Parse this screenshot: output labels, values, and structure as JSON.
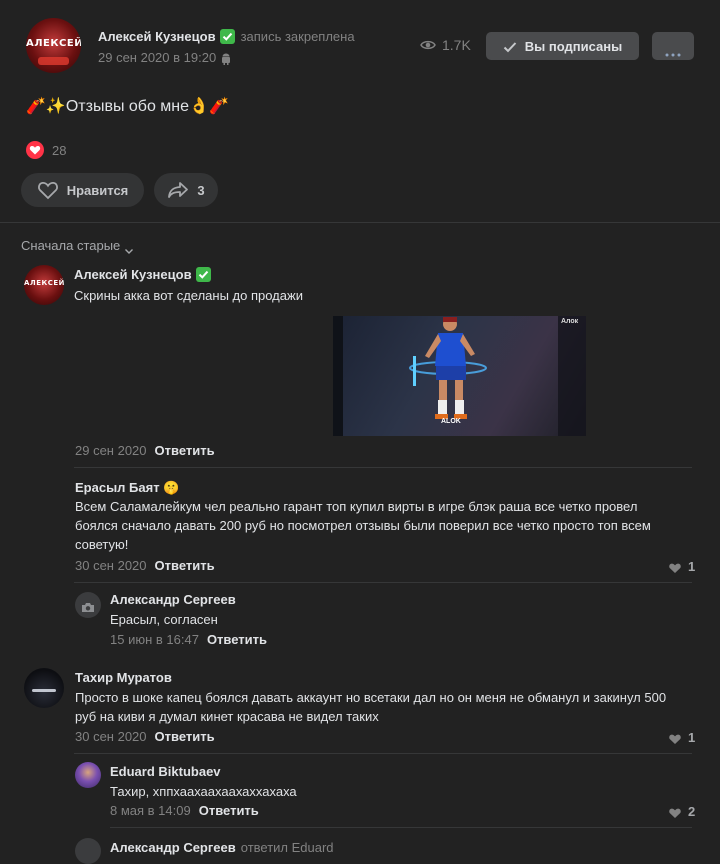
{
  "post": {
    "author": "Алексей Кузнецов",
    "verified_icon": "check-badge-icon",
    "pinned_label": "запись закреплена",
    "date": "29 сен 2020 в 19:20",
    "views": "1.7K",
    "subscribed_label": "Вы подписаны",
    "text": "🧨✨Отзывы обо мне👌🧨",
    "reactions_count": "28",
    "like_label": "Нравится",
    "share_count": "3",
    "avatar_text": "АЛЕКСЕЙ"
  },
  "comments": {
    "sort_label": "Сначала старые",
    "items": [
      {
        "author": "Алексей Кузнецов",
        "text": "Скрины акка вот сделаны до продажи",
        "date": "29 сен 2020",
        "reply": "Ответить",
        "avatar_text": "АЛЕКСЕЙ",
        "image_labels": {
          "title": "Алок",
          "logo": "ALOK"
        }
      },
      {
        "author": "Ерасыл Баят 🤫",
        "text": "Всем Саламалейкум чел реально гарант топ купил вирты в игре блэк раша все четко провел боялся сначало давать 200 руб но посмотрел отзывы были поверил все четко просто топ всем советую!",
        "date": "30 сен 2020",
        "reply": "Ответить",
        "likes": "1"
      },
      {
        "author": "Александр Сергеев",
        "text": "Ерасыл, согласен",
        "date": "15 июн в 16:47",
        "reply": "Ответить"
      },
      {
        "author": "Тахир Муратов",
        "text": "Просто в шоке капец боялся давать аккаунт но всетаки дал но он меня не обманул и закинул 500 руб на киви я думал кинет красава не видел таких",
        "date": "30 сен 2020",
        "reply": "Ответить",
        "likes": "1"
      },
      {
        "author": "Eduard Biktubaev",
        "text": "Тахир, хппхаахаахаахаххахаха",
        "date": "8 мая в 14:09",
        "reply": "Ответить",
        "likes": "2"
      },
      {
        "author": "Александр Сергеев",
        "reply_to": "ответил Eduard"
      }
    ]
  },
  "colors": {
    "background": "#222222",
    "button": "#3a3b3c",
    "heart_red": "#ff3347",
    "muted": "#828282"
  }
}
